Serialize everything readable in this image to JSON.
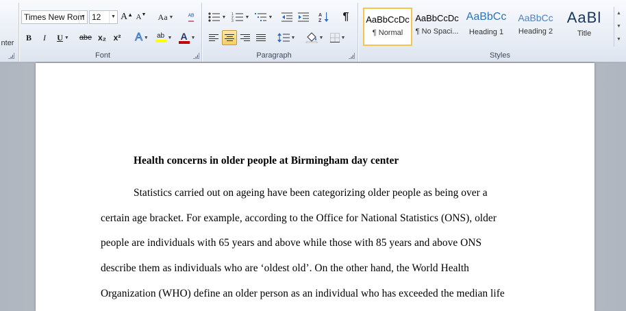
{
  "ribbon": {
    "clipboard": {
      "paste_label": "nter"
    },
    "font": {
      "group_label": "Font",
      "font_name": "Times New Rom",
      "font_size": "12",
      "grow_font": "A",
      "shrink_font": "A",
      "change_case": "Aa",
      "clear_formatting": "ᴬᴮ",
      "bold": "B",
      "italic": "I",
      "underline": "U",
      "strikethrough": "abe",
      "subscript": "x₂",
      "superscript": "x²",
      "text_effects": "A",
      "highlight": "ab",
      "font_color": "A"
    },
    "paragraph": {
      "group_label": "Paragraph",
      "show_marks": "¶"
    },
    "styles": {
      "group_label": "Styles",
      "items": [
        {
          "sample": "AaBbCcDc",
          "name": "¶ Normal"
        },
        {
          "sample": "AaBbCcDc",
          "name": "¶ No Spaci..."
        },
        {
          "sample": "AaBbCc",
          "name": "Heading 1"
        },
        {
          "sample": "AaBbCc",
          "name": "Heading 2"
        },
        {
          "sample": "AaBl",
          "name": "Title"
        }
      ]
    },
    "colors": {
      "selected": "#f8cf60",
      "heading_blue": "#2e74b5",
      "font_color_bar": "#c00000",
      "highlight_bar": "#ffff00"
    }
  },
  "document": {
    "title": "Health concerns in older people at Birmingham day center",
    "lines": [
      "Statistics carried out on ageing have been categorizing older people as being over a",
      "certain age bracket. For example, according to the Office for National Statistics (ONS), older",
      "people are individuals with 65 years and above while those with 85 years and above ONS",
      "describe them as individuals who are ‘oldest old’. On the other hand, the World Health",
      "Organization (WHO) define an older person as an individual who has exceeded the median life"
    ]
  }
}
